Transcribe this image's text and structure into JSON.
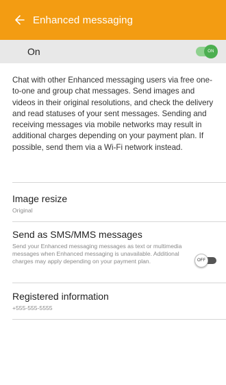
{
  "appbar": {
    "title": "Enhanced messaging",
    "color": "#f39c12"
  },
  "master_switch": {
    "label": "On",
    "state": true,
    "toggle_text": "ON",
    "color": "#4caf50"
  },
  "description": "Chat with other Enhanced messaging users via free one-to-one and group chat messages. Send images and videos in their original resolutions, and check the delivery and read statuses of your sent messages. Sending and receiving messages via mobile networks may result in additional charges depending on your payment plan. If possible, send them via a Wi-Fi network instead.",
  "settings": {
    "image_resize": {
      "title": "Image resize",
      "value": "Original"
    },
    "send_as_sms": {
      "title": "Send as SMS/MMS messages",
      "summary": "Send your Enhanced messaging messages as text or multimedia messages when Enhanced messaging is unavailable. Additional charges may apply depending on your payment plan.",
      "state": false,
      "toggle_text": "OFF"
    },
    "registered_info": {
      "title": "Registered information",
      "value": "+555-555-5555"
    }
  }
}
